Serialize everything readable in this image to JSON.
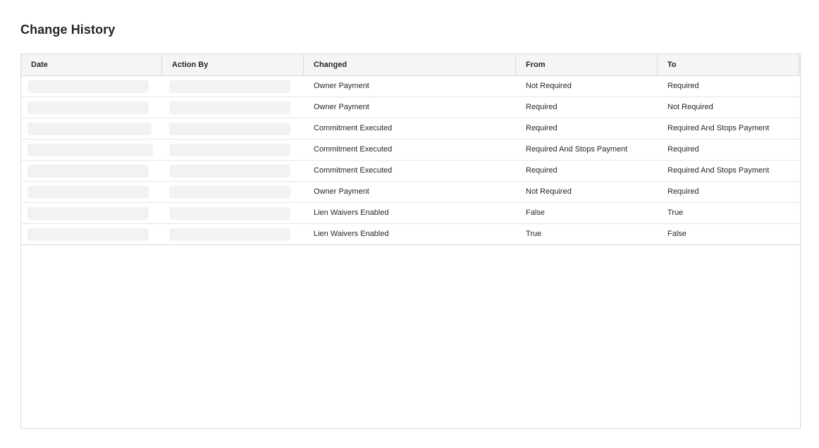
{
  "page": {
    "title": "Change History"
  },
  "table": {
    "columns": [
      "Date",
      "Action By",
      "Changed",
      "From",
      "To"
    ],
    "rows": [
      {
        "changed": "Owner Payment",
        "from": "Not Required",
        "to": "Required"
      },
      {
        "changed": "Owner Payment",
        "from": "Required",
        "to": "Not Required"
      },
      {
        "changed": "Commitment Executed",
        "from": "Required",
        "to": "Required And Stops Payment"
      },
      {
        "changed": "Commitment Executed",
        "from": "Required And Stops Payment",
        "to": "Required"
      },
      {
        "changed": "Commitment Executed",
        "from": "Required",
        "to": "Required And Stops Payment"
      },
      {
        "changed": "Owner Payment",
        "from": "Not Required",
        "to": "Required"
      },
      {
        "changed": "Lien Waivers Enabled",
        "from": "False",
        "to": "True"
      },
      {
        "changed": "Lien Waivers Enabled",
        "from": "True",
        "to": "False"
      }
    ]
  },
  "colors": {
    "header_bg": "#f4f5f6",
    "border": "#d6dadc",
    "skeleton": "#f1f2f3",
    "text": "#232729"
  }
}
